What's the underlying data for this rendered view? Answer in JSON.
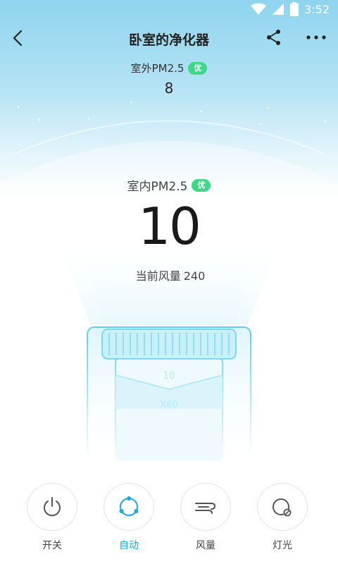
{
  "status_bar": {
    "time": "3:52"
  },
  "header": {
    "title": "卧室的净化器"
  },
  "outdoor": {
    "label": "室外PM2.5",
    "badge": "优",
    "value": "8"
  },
  "indoor": {
    "label": "室内PM2.5",
    "badge": "优",
    "value": "10"
  },
  "airflow": {
    "label": "当前风量",
    "value": "240"
  },
  "filter": {
    "life": "10",
    "multiplier": "X60"
  },
  "controls": {
    "power": "开关",
    "auto": "自动",
    "fan": "风量",
    "light": "灯光"
  },
  "colors": {
    "accent": "#1fa9d7",
    "badge_green": "#3fd88a",
    "sky_top": "#8fd4ee"
  }
}
